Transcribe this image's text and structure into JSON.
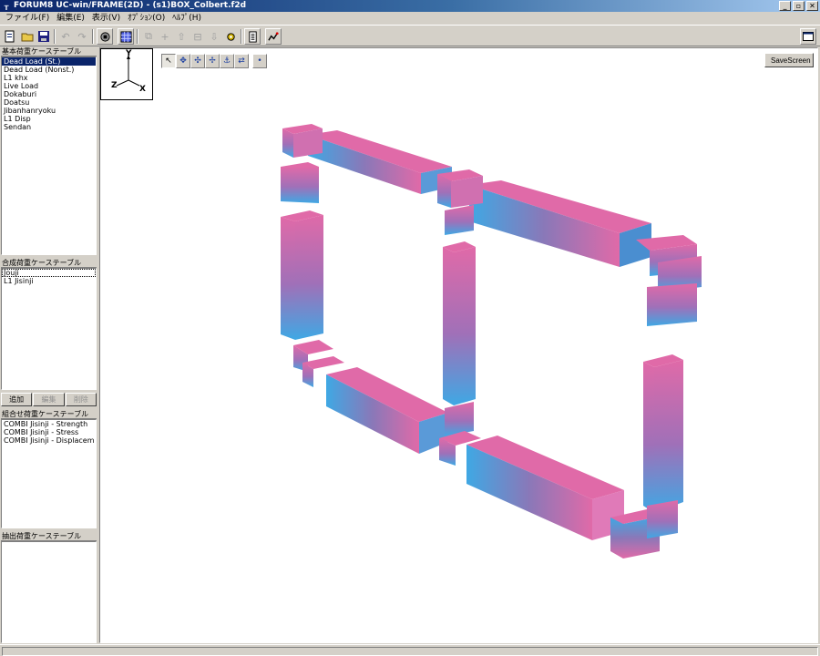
{
  "window": {
    "title": "FORUM8 UC-win/FRAME(2D) - (s1)BOX_Colbert.f2d",
    "app_icon": "frame-app-icon",
    "controls": [
      "_",
      "▫",
      "✕"
    ]
  },
  "menu": [
    {
      "label": "ファイル(F)"
    },
    {
      "label": "編集(E)"
    },
    {
      "label": "表示(V)"
    },
    {
      "label": "ｵﾌﾟｼｮﾝ(O)"
    },
    {
      "label": "ﾍﾙﾌﾟ(H)"
    }
  ],
  "toolbar": {
    "icons": [
      "new-icon",
      "open-icon",
      "save-icon",
      "undo-icon",
      "redo-icon",
      "render-icon",
      "grid-icon",
      "copy-icon",
      "add-icon",
      "move-up-icon",
      "vehicle-icon",
      "move-down-icon",
      "settings-icon",
      "report-icon",
      "chart-icon",
      "window-icon"
    ]
  },
  "panels": {
    "basic_load": {
      "header": "基本荷重ケーステーブル",
      "items": [
        "Dead Load (St.)",
        "Dead Load (Nonst.)",
        "L1 khx",
        "Live Load",
        "Dokaburi",
        "Doatsu",
        "Jibanhanryoku",
        "L1 Disp",
        "Sendan"
      ],
      "selected_index": 0
    },
    "combined_load": {
      "header": "合成荷重ケーステーブル",
      "items": [
        "Jouji",
        "L1 Jisinji"
      ],
      "focused_index": 0
    },
    "buttons": {
      "add": "追加",
      "edit": "編集",
      "delete": "削除"
    },
    "combination_load": {
      "header": "組合せ荷重ケーステーブル",
      "items": [
        "COMBI Jisinji - Strength",
        "COMBI Jisinji - Stress",
        "COMBI Jisinji - Displacem"
      ]
    },
    "extract_load": {
      "header": "抽出荷重ケーステーブル",
      "items": []
    }
  },
  "viewport": {
    "axes": {
      "y": "Y",
      "z": "Z",
      "x": "X"
    },
    "save_screen": "SaveScreen",
    "colors": {
      "member_pink": "#e06aa8",
      "member_blue": "#3fa8e4",
      "member_purple": "#8a78b8"
    }
  }
}
